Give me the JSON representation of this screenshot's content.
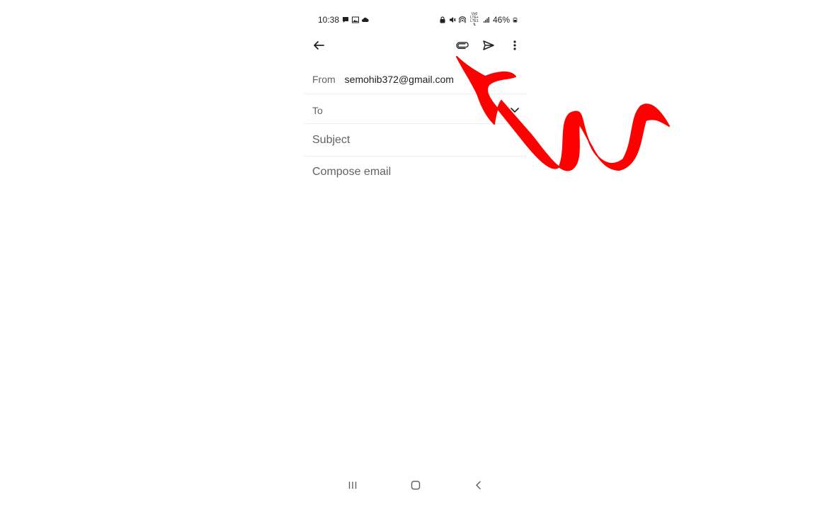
{
  "status_bar": {
    "time": "10:38",
    "battery": "46%",
    "network_label_top": "Vo0 LTE+",
    "network_label_bottom": "LTE1 ⇅",
    "left_icons": [
      "message-icon",
      "image-icon",
      "cloud-icon"
    ],
    "right_icons": [
      "lock-icon",
      "mute-icon",
      "hotspot-icon",
      "network-label",
      "signal-icon",
      "battery-icon"
    ]
  },
  "app_bar": {
    "icons": [
      "back-arrow-icon",
      "attachment-icon",
      "send-icon",
      "more-vert-icon"
    ]
  },
  "compose": {
    "from_label": "From",
    "from_value": "semohib372@gmail.com",
    "to_label": "To",
    "subject_placeholder": "Subject",
    "body_placeholder": "Compose email"
  },
  "nav_bar": {
    "icons": [
      "recents-icon",
      "home-icon",
      "back-icon"
    ]
  },
  "annotation": {
    "color": "#ff0000",
    "shape": "squiggly-arrow",
    "points_to": "attachment-icon"
  },
  "colors": {
    "text_primary": "#202124",
    "text_secondary": "#5f6368",
    "divider": "#eceff1",
    "annotation": "#ff0000"
  }
}
